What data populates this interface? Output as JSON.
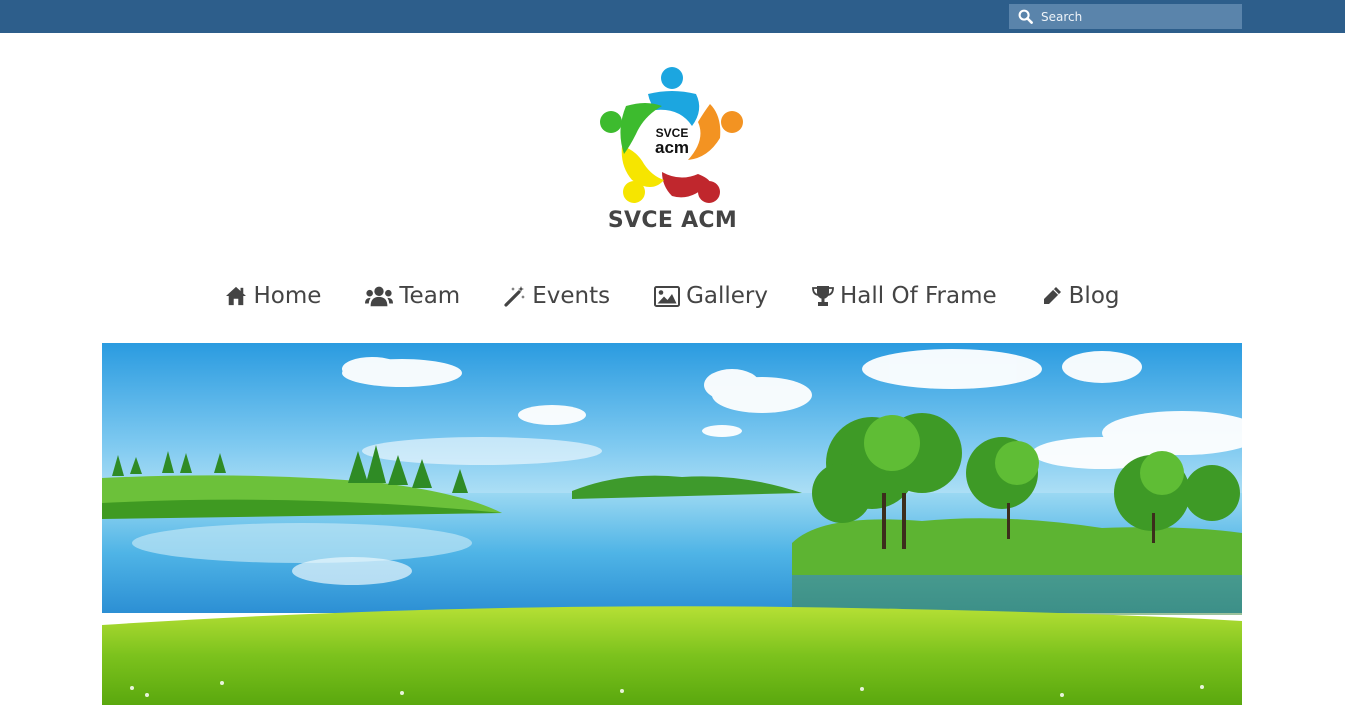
{
  "search": {
    "placeholder": "Search"
  },
  "site": {
    "title": "SVCE ACM",
    "logo_top": "SVCE",
    "logo_bottom": "acm"
  },
  "nav": {
    "items": [
      {
        "label": "Home",
        "icon": "home-icon"
      },
      {
        "label": "Team",
        "icon": "users-icon"
      },
      {
        "label": "Events",
        "icon": "magic-wand-icon"
      },
      {
        "label": "Gallery",
        "icon": "image-icon"
      },
      {
        "label": "Hall Of Frame",
        "icon": "trophy-icon"
      },
      {
        "label": "Blog",
        "icon": "pencil-icon"
      }
    ]
  },
  "colors": {
    "topbar": "#2d5e8b",
    "search_bg": "#5a84ab",
    "text": "#444444",
    "logo_blue": "#1ca6e0",
    "logo_orange": "#f39322",
    "logo_red": "#c0272d",
    "logo_yellow": "#f6e500",
    "logo_green": "#3dbb2e"
  }
}
